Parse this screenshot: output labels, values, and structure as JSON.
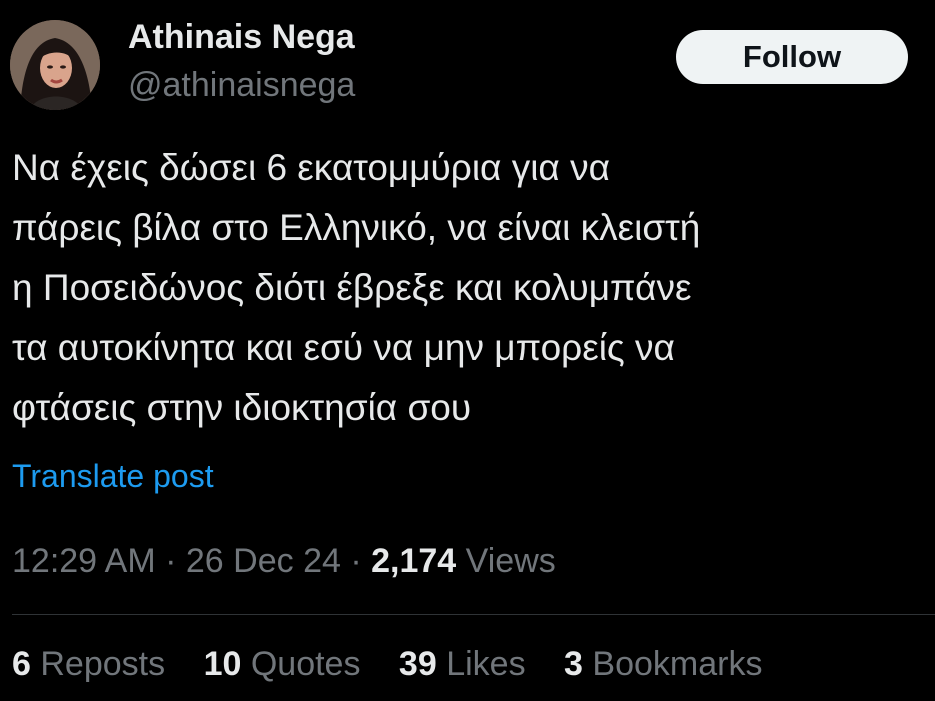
{
  "author": {
    "display_name": "Athinais Nega",
    "handle": "@athinaisnega",
    "avatar_icon": "profile-photo"
  },
  "follow_button": {
    "label": "Follow"
  },
  "tweet": {
    "lines": [
      "Να έχεις δώσει 6 εκατομμύρια για να",
      "πάρεις βίλα στο Ελληνικό, να είναι κλειστή",
      "η Ποσειδώνος διότι έβρεξε και κολυμπάνε",
      "τα αυτοκίνητα και εσύ να μην μπορείς να",
      "φτάσεις στην ιδιοκτησία σου"
    ],
    "translate_label": "Translate post"
  },
  "meta": {
    "time": "12:29 AM",
    "separator": "·",
    "date": "26 Dec 24",
    "views_count": "2,174",
    "views_label": "Views"
  },
  "stats": {
    "reposts": {
      "count": "6",
      "label": "Reposts"
    },
    "quotes": {
      "count": "10",
      "label": "Quotes"
    },
    "likes": {
      "count": "39",
      "label": "Likes"
    },
    "bookmarks": {
      "count": "3",
      "label": "Bookmarks"
    }
  },
  "colors": {
    "background": "#000000",
    "text_primary": "#e7e9ea",
    "text_secondary": "#71767b",
    "link": "#1d9bf0",
    "follow_bg": "#eff3f4",
    "divider": "#2f3336"
  }
}
